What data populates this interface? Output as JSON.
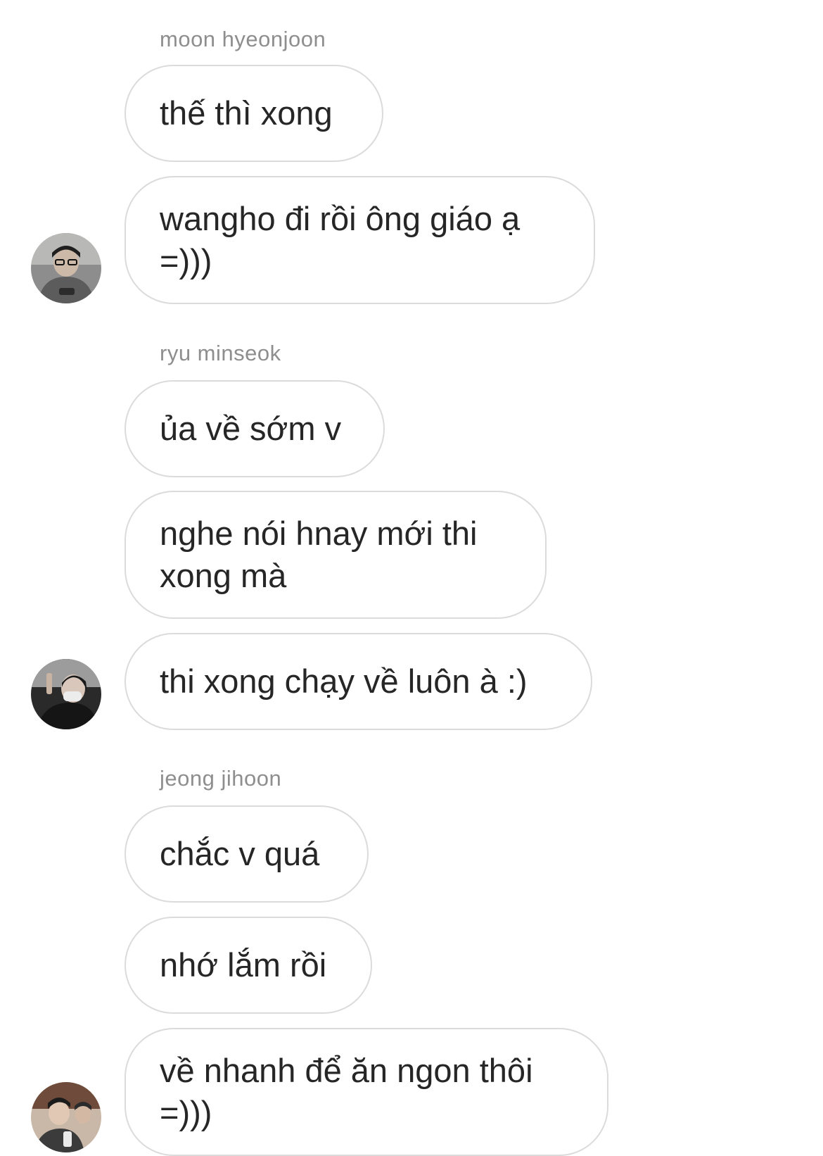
{
  "groups": [
    {
      "sender": "moon hyeonjoon",
      "messages": [
        "thế thì xong",
        "wangho đi rồi ông giáo ạ =)))"
      ]
    },
    {
      "sender": "ryu minseok",
      "messages": [
        "ủa về sớm v",
        "nghe nói hnay mới thi xong mà",
        "thi xong chạy về luôn à :)"
      ]
    },
    {
      "sender": "jeong jihoon",
      "messages": [
        "chắc v quá",
        "nhớ lắm rồi",
        "về nhanh để ăn ngon thôi =)))"
      ]
    }
  ]
}
